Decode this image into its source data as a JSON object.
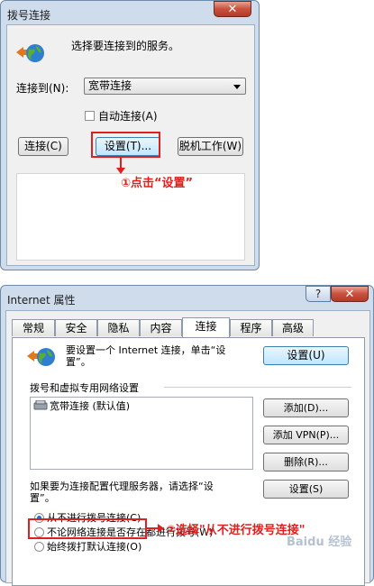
{
  "dialup": {
    "title": "拨号连接",
    "close": "✕",
    "prompt": "选择要连接到的服务。",
    "connect_to_label": "连接到(N):",
    "connection_selected": "宽带连接",
    "auto_connect_label": "自动连接(A)",
    "connect_button": "连接(C)",
    "settings_button": "设置(T)...",
    "offline_button": "脱机工作(W)",
    "annotation": "①点击“设置”"
  },
  "ie": {
    "title": "Internet 属性",
    "help": "?",
    "close": "✕",
    "tabs": [
      "常规",
      "安全",
      "隐私",
      "内容",
      "连接",
      "程序",
      "高级"
    ],
    "active_tab": "连接",
    "setup_text_line1": "要设置一个 Internet 连接，单击“设",
    "setup_text_line2": "置”。",
    "setup_button": "设置(U)",
    "dialup_section_label": "拨号和虚拟专用网络设置",
    "connections": [
      "宽带连接 (默认值)"
    ],
    "add_button": "添加(D)...",
    "add_vpn_button": "添加 VPN(P)...",
    "remove_button": "删除(R)...",
    "proxy_text_line1": "如果要为连接配置代理服务器，请选择“设",
    "proxy_text_line2": "置”。",
    "settings_button": "设置(S)",
    "radio_options": [
      "从不进行拨号连接(C)",
      "不论网络连接是否存在都进行拨号(W)",
      "始终拨打默认连接(O)"
    ],
    "annotation": "②选择\"从不进行拨号连接\""
  },
  "watermark": "Baidu 经验"
}
